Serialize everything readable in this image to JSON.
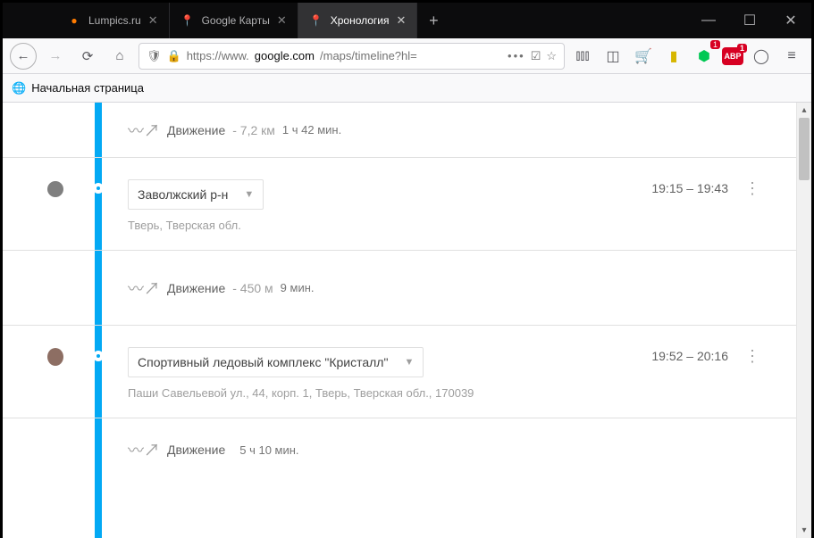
{
  "window": {
    "tabs": [
      {
        "title": "Lumpics.ru",
        "active": false,
        "favicon": "●",
        "fav_color": "#ff7b00"
      },
      {
        "title": "Google Карты",
        "active": false,
        "favicon": "◆",
        "fav_color": "#34a853"
      },
      {
        "title": "Хронология",
        "active": true,
        "favicon": "◆",
        "fav_color": "#ea4335"
      }
    ]
  },
  "url": {
    "prefix": "https://www.",
    "domain": "google.com",
    "path": "/maps/timeline?hl="
  },
  "bookmarks": {
    "home_label": "Начальная страница"
  },
  "ext_badge": "1",
  "timeline": {
    "items": [
      {
        "type": "moving",
        "label": "Движение",
        "dist": "- 7,2 км",
        "time": "1 ч 42 мин."
      },
      {
        "type": "place",
        "marker": "stop",
        "name": "Заволжский р-н",
        "address": "Тверь, Тверская обл.",
        "time": "19:15 – 19:43"
      },
      {
        "type": "moving",
        "label": "Движение",
        "dist": "- 450 м",
        "time": "9 мин."
      },
      {
        "type": "place",
        "marker": "place",
        "name": "Спортивный ледовый комплекс \"Кристалл\"",
        "address": "Паши Савельевой ул., 44, корп. 1, Тверь, Тверская обл., 170039",
        "time": "19:52 – 20:16"
      },
      {
        "type": "moving",
        "label": "Движение",
        "dist": "",
        "time": "5 ч 10 мин."
      }
    ]
  }
}
